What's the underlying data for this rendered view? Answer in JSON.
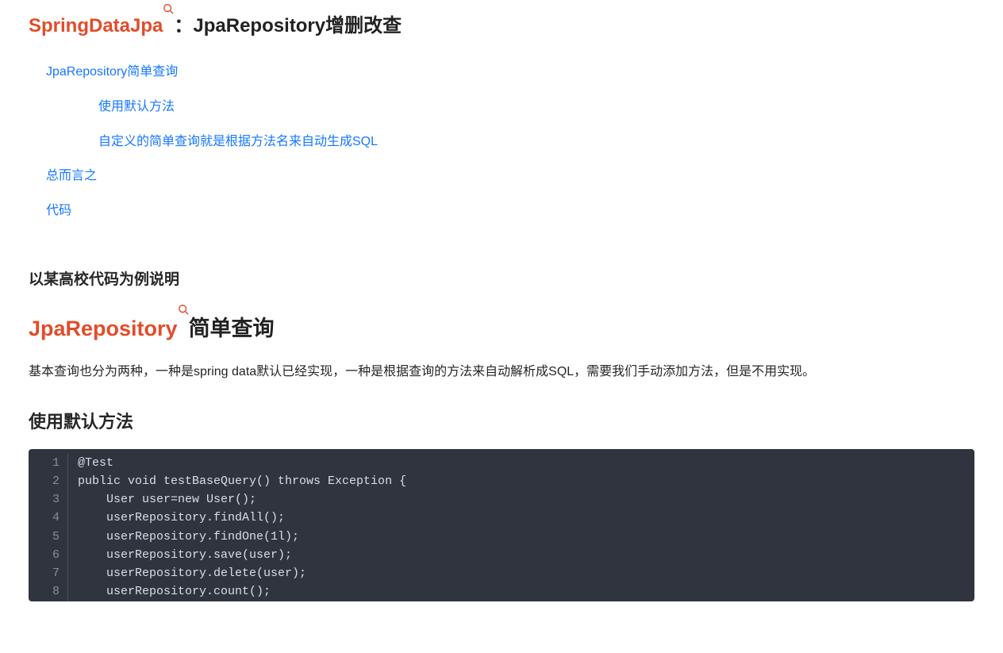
{
  "title": {
    "keyword": "SpringDataJpa",
    "separator": "：",
    "rest": "JpaRepository增删改查"
  },
  "toc": {
    "items": [
      {
        "label": "JpaRepository简单查询",
        "level": 1
      },
      {
        "label": "使用默认方法",
        "level": 2
      },
      {
        "label": "自定义的简单查询就是根据方法名来自动生成SQL",
        "level": 2
      },
      {
        "label": "总而言之",
        "level": 1
      },
      {
        "label": "代码",
        "level": 1
      }
    ]
  },
  "body": {
    "example_heading": "以某高校代码为例说明",
    "h2": {
      "keyword": "JpaRepository",
      "rest": "简单查询"
    },
    "para1": "基本查询也分为两种，一种是spring data默认已经实现，一种是根据查询的方法来自动解析成SQL，需要我们手动添加方法，但是不用实现。",
    "h3_default": "使用默认方法",
    "code_lines": [
      "@Test",
      "public void testBaseQuery() throws Exception {",
      "    User user=new User();",
      "    userRepository.findAll();",
      "    userRepository.findOne(1l);",
      "    userRepository.save(user);",
      "    userRepository.delete(user);",
      "    userRepository.count();"
    ]
  }
}
